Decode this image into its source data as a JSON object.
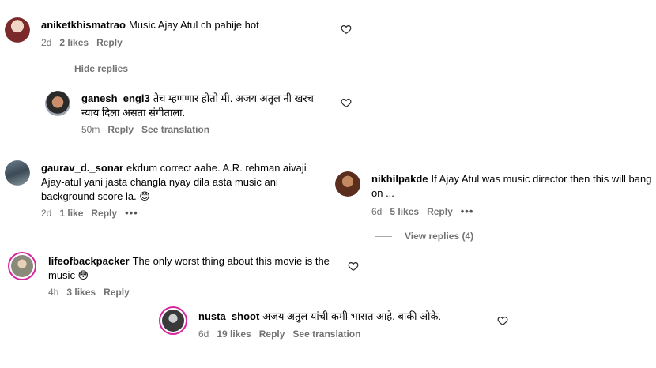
{
  "comments": [
    {
      "username": "aniketkhismatrao",
      "text": "Music Ajay Atul ch pahije hot",
      "time": "2d",
      "likes": "2 likes",
      "reply": "Reply"
    },
    {
      "username": "ganesh_engi3",
      "text": "तेच म्हणणार होतो मी. अजय अतुल नी खरच न्याय दिला असता संगीताला.",
      "time": "50m",
      "reply": "Reply",
      "translation": "See translation"
    },
    {
      "username": "gaurav_d._sonar",
      "text": "ekdum correct aahe. A.R. rehman aivaji Ajay-atul yani jasta changla nyay dila asta music ani background score la. 😊",
      "time": "2d",
      "likes": "1 like",
      "reply": "Reply",
      "more": "•••"
    },
    {
      "username": "nikhilpakde",
      "text": "If Ajay Atul was music director then this will bang on ...",
      "time": "6d",
      "likes": "5 likes",
      "reply": "Reply",
      "more": "•••"
    },
    {
      "username": "lifeofbackpacker",
      "text": "The only worst thing about this movie is the music 😳",
      "time": "4h",
      "likes": "3 likes",
      "reply": "Reply"
    },
    {
      "username": "nusta_shoot",
      "text": "अजय अतुल यांची कमी भासत आहे. बाकी ओके.",
      "time": "6d",
      "likes": "19 likes",
      "reply": "Reply",
      "translation": "See translation"
    }
  ],
  "hide_replies": "Hide replies",
  "view_replies": "View replies (4)"
}
